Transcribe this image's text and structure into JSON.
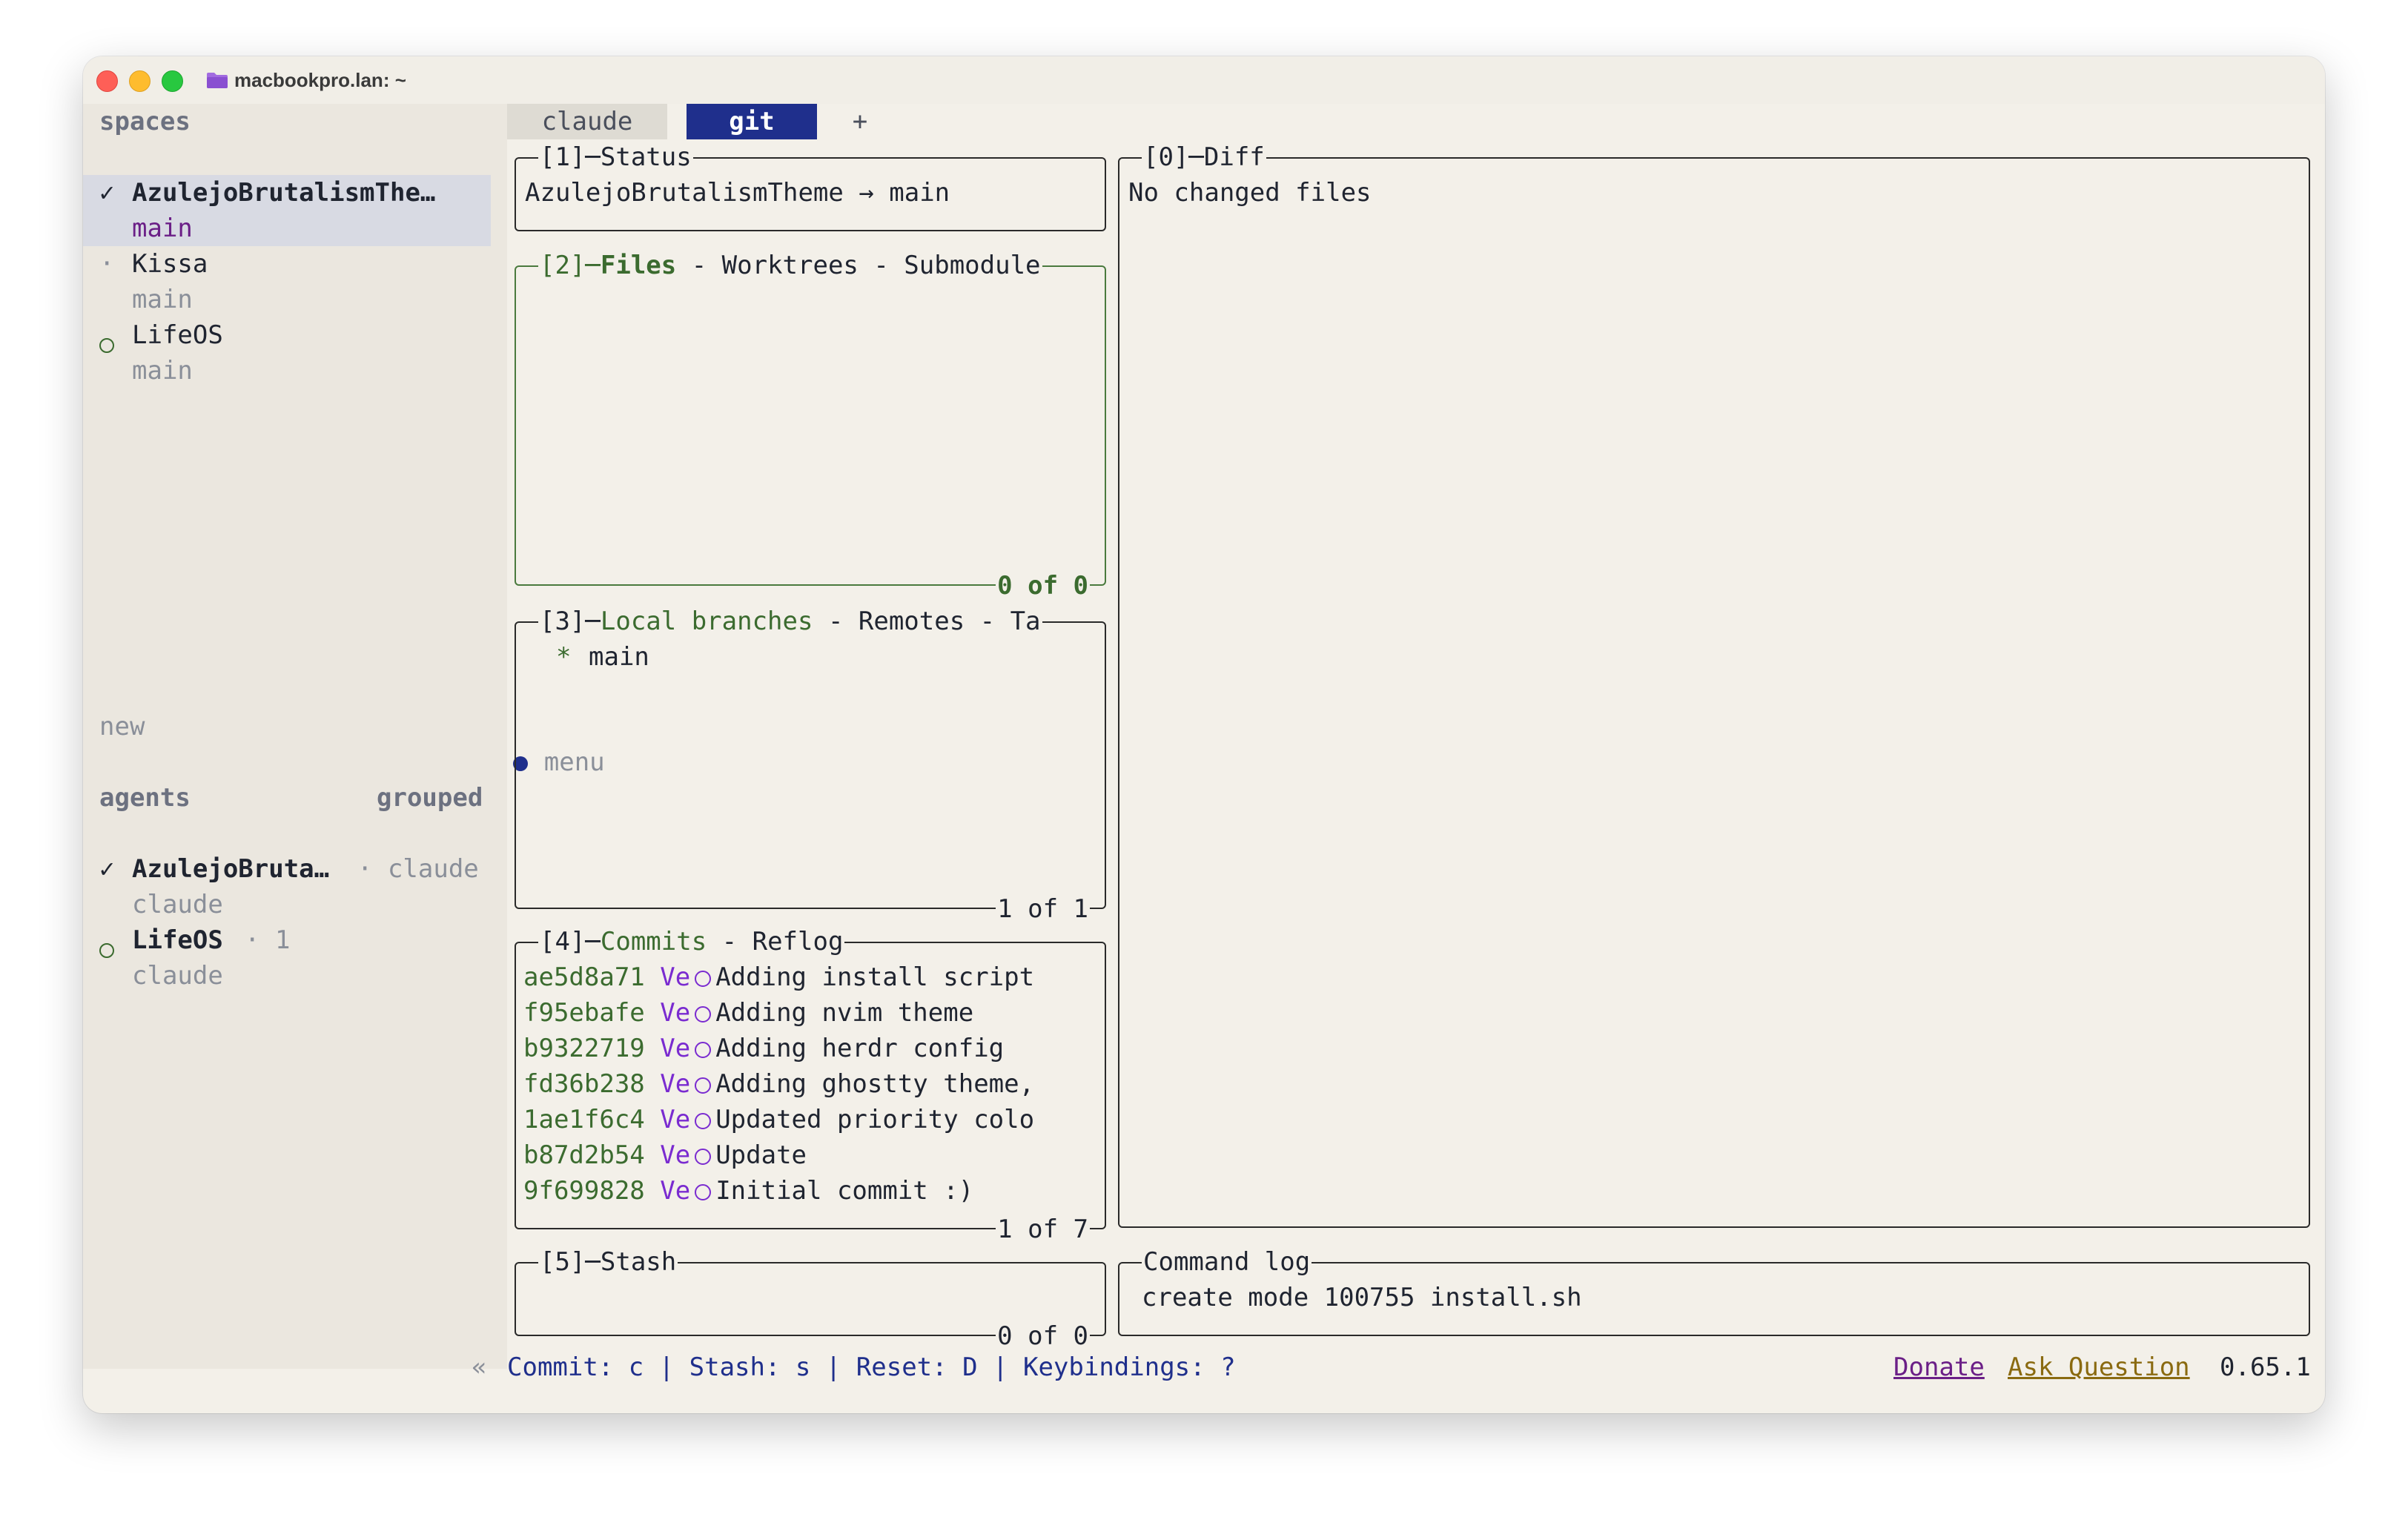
{
  "window": {
    "title": "macbookpro.lan: ~"
  },
  "sidebar": {
    "spaces_header": "spaces",
    "spaces": [
      {
        "status": "✓",
        "name": "AzulejoBrutalismThe…",
        "branch": "main",
        "selected": true
      },
      {
        "status": "·",
        "name": "Kissa",
        "branch": "main",
        "selected": false
      },
      {
        "status": "○",
        "name": "LifeOS",
        "branch": "main",
        "selected": false
      }
    ],
    "new_label": "new",
    "menu_label": "menu",
    "agents_header": "agents",
    "grouped_label": "grouped",
    "agents": [
      {
        "status": "✓",
        "name": "AzulejoBruta…",
        "meta": "· claude",
        "sub": "claude"
      },
      {
        "status": "○",
        "name": "LifeOS",
        "meta": "· 1",
        "sub": "claude"
      }
    ],
    "collapse_label": "«"
  },
  "tabs": [
    {
      "label": "claude",
      "active": false
    },
    {
      "label": "git",
      "active": true
    },
    {
      "label": "+",
      "active": false
    }
  ],
  "panels": {
    "status": {
      "title": "[1]─Status",
      "content": "AzulejoBrutalismTheme → main"
    },
    "files": {
      "index": "[2]─",
      "tabs": [
        "Files",
        " - Worktrees - Submodule"
      ],
      "footer": "0 of 0"
    },
    "branches": {
      "index": "[3]─",
      "tabs": [
        "Local branches",
        " - Remotes - Ta"
      ],
      "items": [
        {
          "marker": "*",
          "name": "main"
        }
      ],
      "footer": "1 of 1"
    },
    "commits": {
      "index": "[4]─",
      "tabs": [
        "Commits",
        " - Reflog"
      ],
      "footer": "1 of 7",
      "items": [
        {
          "hash": "ae5d8a71",
          "author": "Ve",
          "message": "Adding install script"
        },
        {
          "hash": "f95ebafe",
          "author": "Ve",
          "message": "Adding nvim theme"
        },
        {
          "hash": "b9322719",
          "author": "Ve",
          "message": "Adding herdr config"
        },
        {
          "hash": "fd36b238",
          "author": "Ve",
          "message": "Adding ghostty theme,"
        },
        {
          "hash": "1ae1f6c4",
          "author": "Ve",
          "message": "Updated priority colo"
        },
        {
          "hash": "b87d2b54",
          "author": "Ve",
          "message": "Update"
        },
        {
          "hash": "9f699828",
          "author": "Ve",
          "message": "Initial commit :)"
        }
      ]
    },
    "stash": {
      "title": "[5]─Stash",
      "footer": "0 of 0"
    },
    "diff": {
      "title": "[0]─Diff",
      "content": "No changed files"
    },
    "command_log": {
      "title": "Command log",
      "content": "create mode 100755 install.sh"
    }
  },
  "footer": {
    "keybindings": "Commit: c | Stash: s | Reset: D | Keybindings: ?",
    "donate": "Donate",
    "ask": "Ask Question",
    "version": "0.65.1"
  },
  "colors": {
    "background": "#f3f0e9",
    "sidebar_bg": "#ebe7df",
    "active_tab": "#1f2f8c",
    "active_border": "#4a7a3e",
    "hash_green": "#3b6b2f",
    "author_violet": "#7a2bd0"
  }
}
